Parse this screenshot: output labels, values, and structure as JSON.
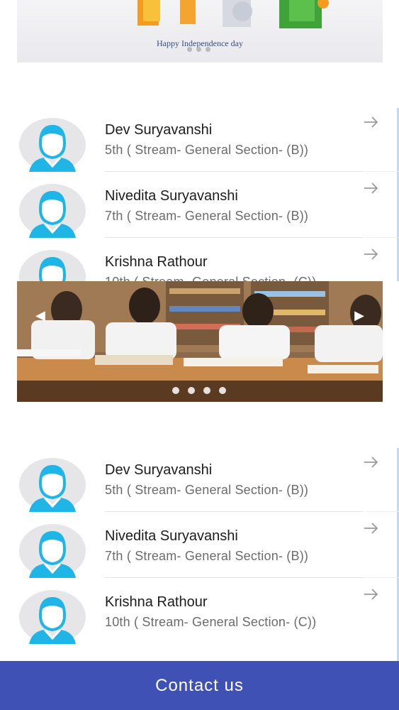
{
  "top_banner": {
    "caption": "Happy Independence day",
    "pager_count": 3
  },
  "students_first": [
    {
      "name": "Dev Suryavanshi",
      "detail": "5th ( Stream- General  Section- (B))"
    },
    {
      "name": "Nivedita Suryavanshi",
      "detail": "7th ( Stream- General  Section- (B))"
    },
    {
      "name": "Krishna Rathour",
      "detail": "10th ( Stream- General  Section- (C))"
    }
  ],
  "photo_carousel": {
    "pager_count": 4,
    "prev_icon": "◀",
    "next_icon": "▶"
  },
  "students_second": [
    {
      "name": "Dev Suryavanshi",
      "detail": "5th ( Stream- General  Section- (B))"
    },
    {
      "name": "Nivedita Suryavanshi",
      "detail": "7th ( Stream- General  Section- (B))"
    },
    {
      "name": "Krishna Rathour",
      "detail": "10th ( Stream- General  Section- (C))"
    }
  ],
  "contact_button": {
    "label": "Contact us"
  },
  "colors": {
    "accent": "#3f51b5",
    "avatar_bg": "#e6e6e8",
    "avatar_figure": "#1fb5e6"
  }
}
